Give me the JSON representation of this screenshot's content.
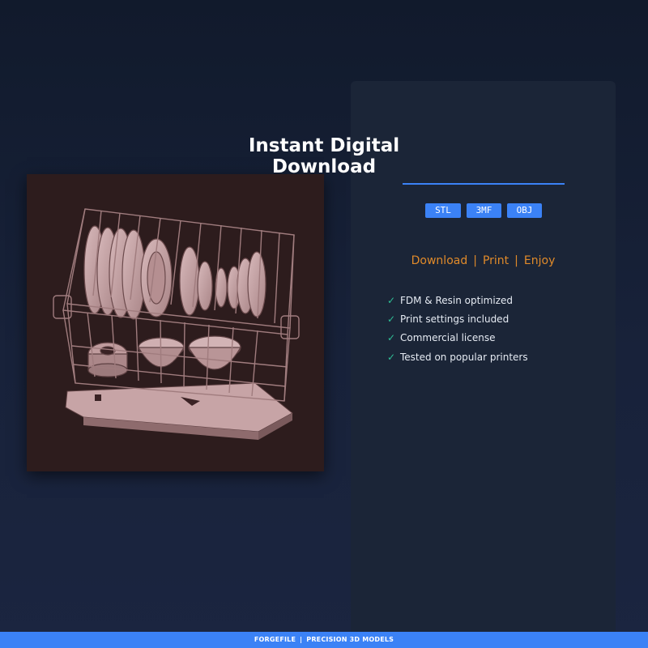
{
  "product": {
    "image_alt": "3D model of a dish drying rack with plates and bowls"
  },
  "panel": {
    "title_line1": "Instant Digital",
    "title_line2": "Download",
    "formats": [
      "STL",
      "3MF",
      "OBJ"
    ],
    "tagline": {
      "step1": "Download",
      "step2": "Print",
      "step3": "Enjoy",
      "separator": "|"
    },
    "features": [
      "FDM & Resin optimized",
      "Print settings included",
      "Commercial license",
      "Tested on popular printers"
    ],
    "check_icon": "✓"
  },
  "footer": {
    "brand": "FORGEFILE",
    "separator": "|",
    "tagline": "PRECISION 3D MODELS"
  },
  "colors": {
    "accent": "#3b82f6",
    "tagline": "#e08a2a",
    "check": "#2fbf96",
    "panel_bg": "#1b2537",
    "model": "#c9a8aa"
  }
}
